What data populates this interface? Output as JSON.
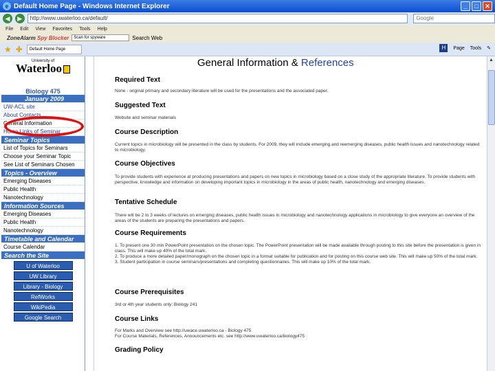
{
  "browser": {
    "title": "Default Home Page - Windows Internet Explorer",
    "address": "http://www.uwaterloo.ca/default/",
    "search_placeholder": "Google",
    "menu": [
      "File",
      "Edit",
      "View",
      "Favorites",
      "Tools",
      "Help"
    ],
    "zonealarm": {
      "label": "ZoneAlarm",
      "spy": "Spy Blocker",
      "field": "Scan for spyware",
      "search_label": "Search Web"
    },
    "tab_label": "Default Home Page",
    "tools": {
      "page": "Page",
      "tools": "Tools"
    }
  },
  "sidebar": {
    "university_small": "University of",
    "university_name": "Waterloo",
    "course": "Biology 475",
    "term": "January 2009",
    "links_top": [
      "UW-ACL site",
      "About Contacts",
      "General Information",
      "Home Links of Seminar"
    ],
    "seminar_header": "Seminar Topics",
    "seminar_links": [
      "List of Topics for Seminars",
      "Choose your Seminar Topic",
      "See List of Seminars Chosen"
    ],
    "overview_header": "Topics - Overview",
    "overview_links": [
      "Emerging Diseases",
      "Public Health",
      "Nanotechnology"
    ],
    "info_header": "Information Sources",
    "info_links": [
      "Emerging Diseases",
      "Public Health",
      "Nanotechnology"
    ],
    "timetable_header": "Timetable and Calendar",
    "timetable_links": [
      "Course Calendar"
    ],
    "search_header": "Search the Site",
    "search_buttons": [
      "U of Waterloo",
      "UW Library",
      "Library - Biology",
      "RefWorks",
      "WikiPedia",
      "Google Search"
    ]
  },
  "main": {
    "title_part1": "General Information &",
    "title_part2": "References",
    "sections": [
      {
        "heading": "Required Text",
        "body": "None - original primary and secondary literature will be used for the presentations and the associated paper."
      },
      {
        "heading": "Suggested Text",
        "body": "Website and seminar materials"
      },
      {
        "heading": "Course Description",
        "body": "Current topics in microbiology will be presented in the class by students. For 2009, they will include emerging and reemerging diseases, public health issues and nanotechnology related to microbiology."
      },
      {
        "heading": "Course Objectives",
        "body": "To provide students with experience at producing presentations and papers on new topics in microbiology based on a close study of the appropriate literature. To provide students with perspective, knowledge and information on developing important topics in microbiology in the areas of public health, nanotechnology and emerging diseases."
      },
      {
        "heading": "Tentative Schedule",
        "body": "There will be 2 to 3 weeks of lectures on emerging diseases, public health issues in microbiology and nanotechnology applications in microbiology to give everyone an overview of the areas of the students are preparing the presentations and papers."
      },
      {
        "heading": "Course Requirements",
        "body": "1. To present one 30 min PowerPoint presentation on the chosen topic. The PowerPoint presentation will be made available through posting to this site before the presentation is given in class. This will make up 40% of the total mark.\n2. To produce a more detailed paper/monograph on the chosen topic in a format suitable for publication and for posting on this course web site. This will make up 50% of the total mark.\n3. Student participation in course seminars/presentations and completing questionnaires. This will make up 10% of the total mark."
      },
      {
        "heading": "Course Prerequisites",
        "body": "3rd or 4th year students only; Biology 241"
      },
      {
        "heading": "Course Links",
        "body": "For Marks and Overview see http://uwace.uwaterloo.ca - Biology 475\nFor Course Materials, References, Announcements etc. see http://www.uwaterloo.ca/biology475"
      },
      {
        "heading": "Grading Policy",
        "body": ""
      }
    ]
  }
}
